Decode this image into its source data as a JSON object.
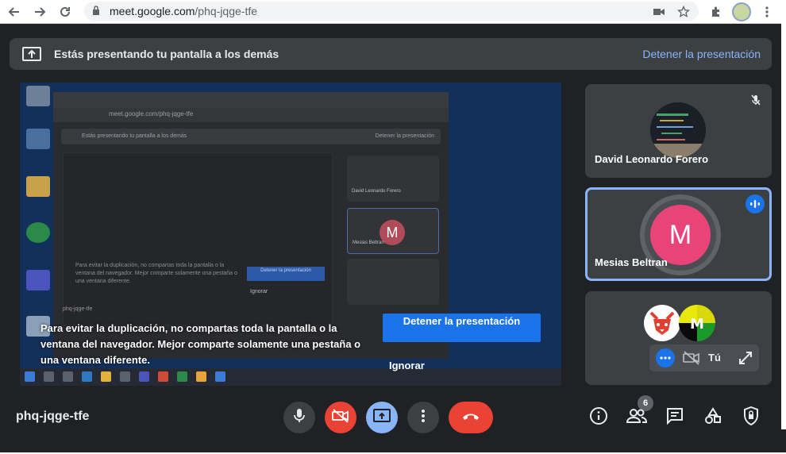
{
  "browser": {
    "url_host": "meet.google.com",
    "url_path": "/phq-jqge-tfe"
  },
  "banner": {
    "message": "Estás presentando tu pantalla a los demás",
    "stop_label": "Detener la presentación"
  },
  "duplication_notice": {
    "text": "Para evitar la duplicación, no compartas toda la pantalla o la ventana del navegador. Mejor comparte solamente una pestaña o una ventana diferente.",
    "stop_button": "Detener la presentación",
    "ignore_button": "Ignorar"
  },
  "shared_screen": {
    "inner_url": "meet.google.com/phq-jqge-tfe",
    "inner_banner_left": "Estás presentando tu pantalla a los demás",
    "inner_banner_right": "Detener la presentación",
    "inner_tile_1": "David Leonardo Forero",
    "inner_tile_2": "Mesias Beltran",
    "inner_avatar_letter": "M",
    "inner_notice": "Para evitar la duplicación, no compartas toda la pantalla o la ventana del navegador. Mejor comparte solamente una pestaña o una ventana diferente.",
    "inner_stop": "Detener la presentación",
    "inner_ignore": "Ignorar",
    "inner_code": "phq-jqge-tfe"
  },
  "participants": [
    {
      "name": "David Leonardo Forero",
      "muted": true
    },
    {
      "name": "Mesias Beltran",
      "avatar_letter": "M",
      "avatar_color": "#e8447a",
      "speaking": true
    },
    {
      "name": "Tú",
      "camera_off": true
    }
  ],
  "meeting": {
    "code": "phq-jqge-tfe",
    "participant_count": "6"
  },
  "colors": {
    "accent": "#8ab4f8",
    "end_call": "#ea4335",
    "primary_button": "#1a73e8"
  },
  "icons": [
    "back-icon",
    "forward-icon",
    "reload-icon",
    "lock-icon",
    "camera-icon",
    "star-icon",
    "extensions-icon",
    "menu-icon",
    "present-icon",
    "mic-off-icon",
    "audio-wave-icon",
    "more-icon",
    "camera-off-icon",
    "expand-icon",
    "mic-icon",
    "present-screen-icon",
    "end-call-icon",
    "info-icon",
    "people-icon",
    "chat-icon",
    "activities-icon",
    "host-controls-icon"
  ]
}
